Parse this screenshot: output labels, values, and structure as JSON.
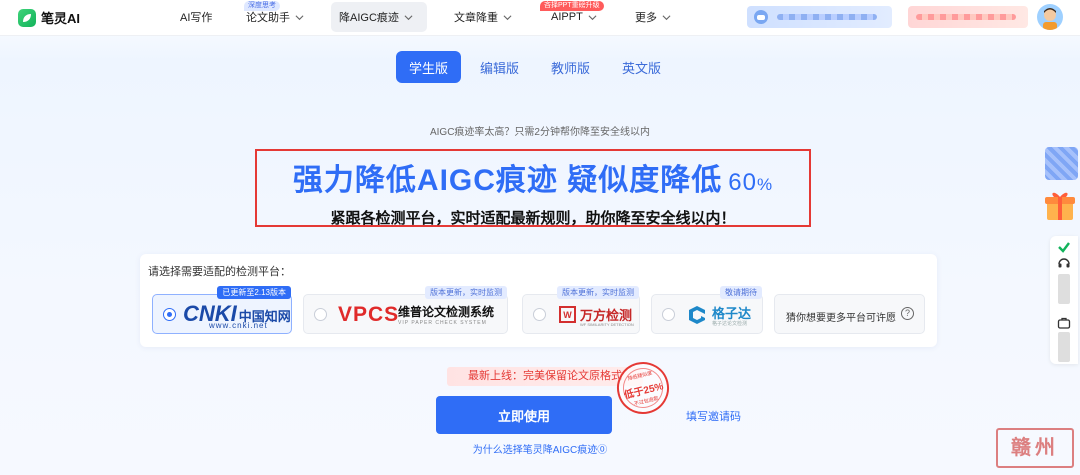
{
  "app": {
    "name": "笔灵AI"
  },
  "nav": {
    "items": [
      {
        "label": "AI写作"
      },
      {
        "label": "论文助手",
        "badge": "深度思考"
      },
      {
        "label": "降AIGC痕迹"
      },
      {
        "label": "文章降重"
      },
      {
        "label": "AIPPT",
        "badge": "吝择PPT重磅升级"
      },
      {
        "label": "更多"
      }
    ]
  },
  "tabs": [
    {
      "label": "学生版",
      "active": true
    },
    {
      "label": "编辑版"
    },
    {
      "label": "教师版"
    },
    {
      "label": "英文版"
    }
  ],
  "hero": {
    "subtitle": "AIGC痕迹率太高？只需2分钟帮你降至安全线以内",
    "title": "强力降低AIGC痕迹 疑似度降低",
    "percent": "60",
    "percent_unit": "%",
    "desc": "紧跟各检测平台，实时适配最新规则，助你降至安全线以内！"
  },
  "platforms": {
    "label": "请选择需要适配的检测平台：",
    "items": [
      {
        "badge": "已更新至2.13版本",
        "logo_main": "CNKI",
        "logo_cn": "中国知网",
        "url": "www.cnki.net",
        "selected": true
      },
      {
        "badge": "版本更新，实时监测",
        "logo_main": "VPCS",
        "name": "维普论文检测系统",
        "en": "VIP PAPER CHECK SYSTEM"
      },
      {
        "badge": "版本更新，实时监测",
        "name": "万方检测",
        "en": "WF SIMILARITY DETECTION"
      },
      {
        "badge": "敬请期待",
        "name": "格子达",
        "en": "格子达论文检测"
      }
    ],
    "more": "猜你想要更多平台可许愿",
    "help_glyph": "?"
  },
  "cta": {
    "new_tag": "最新上线：完美保留论文原格式",
    "stamp_top": "降低疑似度",
    "stamp_main": "低于25%",
    "stamp_bottom": "不过包退款",
    "use_button": "立即使用",
    "invite_link": "填写邀请码",
    "why_link": "为什么选择笔灵降AIGC痕迹⓪"
  },
  "watermark": "赣州",
  "colors": {
    "accent": "#2f6df6",
    "alert": "#e53935",
    "brand_green": "#12b35b"
  }
}
